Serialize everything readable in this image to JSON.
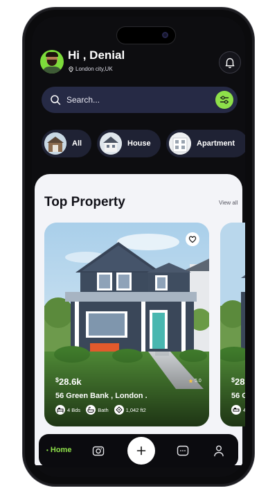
{
  "header": {
    "greeting": "Hi , Denial",
    "location": "London city,UK"
  },
  "search": {
    "placeholder": "Search..."
  },
  "categories": [
    {
      "label": "All"
    },
    {
      "label": "House"
    },
    {
      "label": "Apartment"
    }
  ],
  "section": {
    "title": "Top Property",
    "view_all": "View all"
  },
  "properties": [
    {
      "currency": "$",
      "price": "28.6k",
      "address": "56 Green Bank , London .",
      "rating": "5.0",
      "beds": "4 Bds",
      "bath": "Bath",
      "area": "1,042 ft2"
    },
    {
      "currency": "$",
      "price": "28.",
      "address": "56 G",
      "beds": "4"
    }
  ],
  "nav": {
    "home_label": "Home",
    "items": [
      "camera-icon",
      "add-icon",
      "message-icon",
      "profile-icon"
    ]
  },
  "colors": {
    "accent": "#8ee04a",
    "background": "#0d0d10",
    "sheet": "#f3f4f8",
    "search_bg": "#262a45"
  }
}
